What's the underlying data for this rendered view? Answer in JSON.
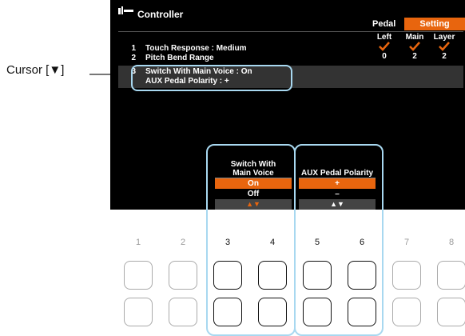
{
  "annotation": {
    "cursor_label": "Cursor [▼]"
  },
  "screen": {
    "title": "Controller",
    "tabs": [
      {
        "label": "Pedal"
      },
      {
        "label": "Setting",
        "active": true
      }
    ],
    "columns": [
      "Left",
      "Main",
      "Layer"
    ],
    "rows": [
      {
        "num": "1",
        "label": "Touch Response : Medium"
      },
      {
        "num": "2",
        "label": "Pitch Bend Range"
      },
      {
        "num": "3",
        "line1": "Switch With Main Voice : On",
        "line2": "AUX Pedal Polarity : +"
      }
    ],
    "pitch_bend_values": [
      "0",
      "2",
      "2"
    ],
    "touch_checks": [
      "check-icon",
      "check-icon",
      "check-icon"
    ],
    "accent_color": "#e8650e"
  },
  "menus": [
    {
      "title_line1": "Switch With",
      "title_line2": "Main Voice",
      "options": [
        "On",
        "Off"
      ],
      "selected": "On",
      "arrows": "▲▼"
    },
    {
      "title_line1": "AUX Pedal Polarity",
      "options": [
        "+",
        "–"
      ],
      "selected": "+",
      "arrows": "▲▼"
    }
  ],
  "buttons": {
    "numbers": [
      "1",
      "2",
      "3",
      "4",
      "5",
      "6",
      "7",
      "8"
    ]
  }
}
